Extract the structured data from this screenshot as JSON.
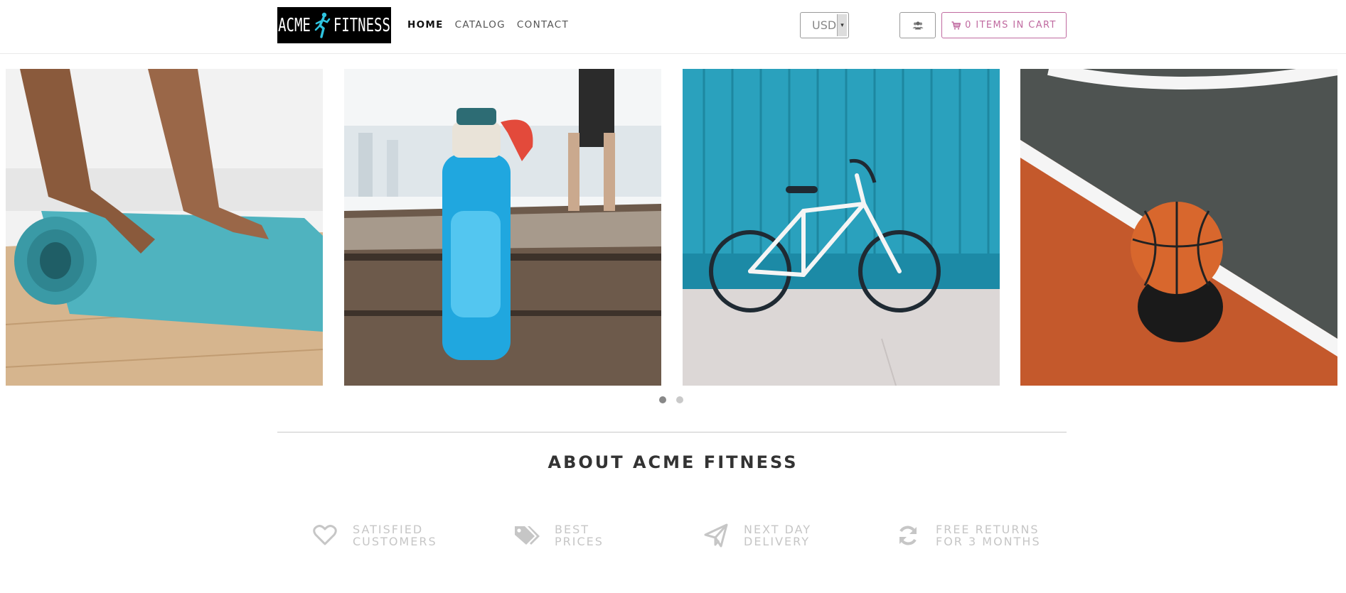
{
  "header": {
    "logo_text_left": "ACME",
    "logo_text_right": "FITNESS",
    "nav": [
      {
        "label": "HOME",
        "active": true
      },
      {
        "label": "CATALOG",
        "active": false
      },
      {
        "label": "CONTACT",
        "active": false
      }
    ],
    "currency": "USD",
    "user_icon": "users-icon",
    "cart_icon": "shopping-cart-icon",
    "cart_label": "0 ITEMS IN CART",
    "accent_color": "#c06aa0"
  },
  "carousel": {
    "slides": [
      {
        "subject": "yoga mat"
      },
      {
        "subject": "water bottle"
      },
      {
        "subject": "bicycle"
      },
      {
        "subject": "basketball"
      }
    ],
    "dots": 2,
    "active_dot": 0
  },
  "about": {
    "title": "ABOUT ACME FITNESS",
    "features": [
      {
        "icon": "heart-icon",
        "line1": "SATISFIED",
        "line2": "CUSTOMERS"
      },
      {
        "icon": "tags-icon",
        "line1": "BEST",
        "line2": "PRICES"
      },
      {
        "icon": "paper-plane-icon",
        "line1": "NEXT DAY",
        "line2": "DELIVERY"
      },
      {
        "icon": "refresh-icon",
        "line1": "FREE RETURNS",
        "line2": "FOR 3 MONTHS"
      }
    ]
  }
}
